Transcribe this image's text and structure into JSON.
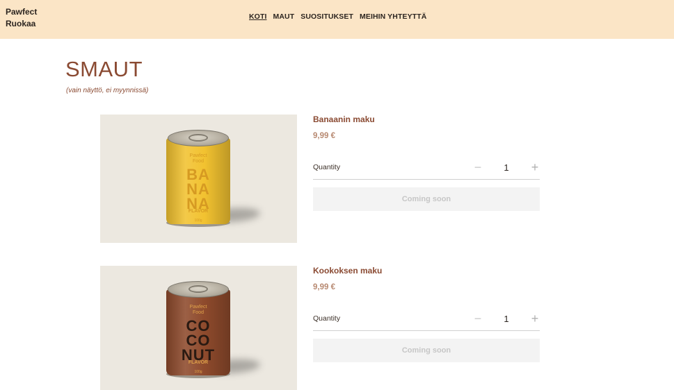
{
  "header": {
    "logo_line1": "Pawfect",
    "logo_line2": "Ruokaa",
    "nav": [
      {
        "label": "KOTI",
        "active": true
      },
      {
        "label": "MAUT",
        "active": false
      },
      {
        "label": "SUOSITUKSET",
        "active": false
      },
      {
        "label": "MEIHIN YHTEYTTÄ",
        "active": false
      }
    ]
  },
  "page": {
    "title": "SMAUT",
    "subtitle": "(vain näyttö, ei myynnissä)"
  },
  "products": [
    {
      "name": "Banaanin maku",
      "price": "9,99 €",
      "quantity_label": "Quantity",
      "quantity": "1",
      "button_label": "Coming soon",
      "can": {
        "brand_line1": "Pawfect",
        "brand_line2": "Food",
        "big_line1": "BA",
        "big_line2": "NA",
        "big_line3": "NA",
        "flavor": "FLAVOR",
        "weight": "100g",
        "body_color": "#f2c230",
        "text_color": "#d69a22"
      }
    },
    {
      "name": "Kookoksen maku",
      "price": "9,99 €",
      "quantity_label": "Quantity",
      "quantity": "1",
      "button_label": "Coming soon",
      "can": {
        "brand_line1": "Pawfect",
        "brand_line2": "Food",
        "big_line1": "CO",
        "big_line2": "CO",
        "big_line3": "NUT",
        "flavor": "FLAVOR",
        "weight": "100g",
        "body_color": "#8e4a2c",
        "text_color": "#e0a24a"
      }
    }
  ],
  "colors": {
    "header_bg": "#fbe5c6",
    "accent": "#8a4a32",
    "price": "#b88a72",
    "button_bg": "#f3f3f3",
    "button_text": "#c6c6c6"
  },
  "icons": {
    "minus": "minus-icon",
    "plus": "plus-icon"
  }
}
